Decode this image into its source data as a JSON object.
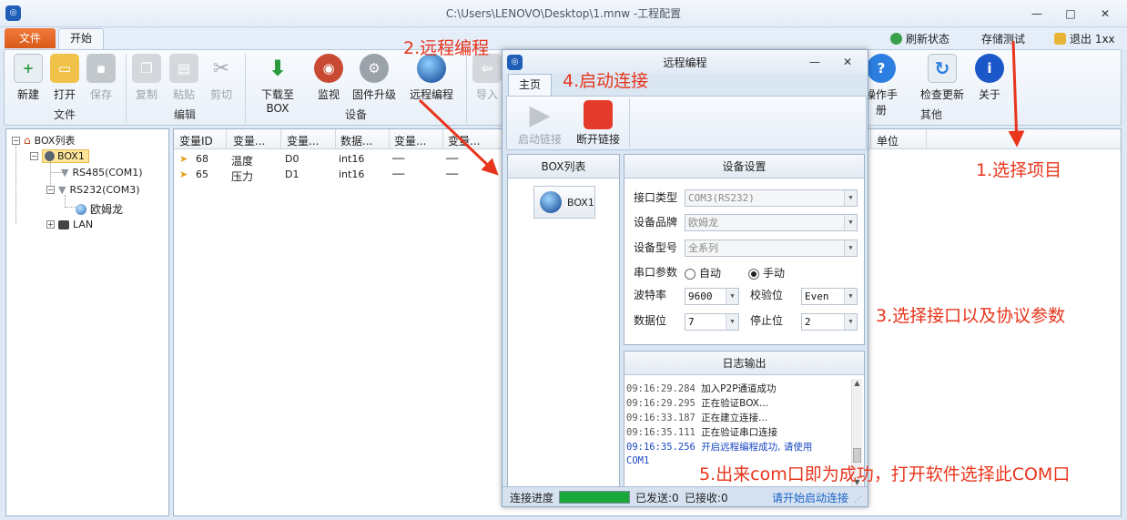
{
  "window": {
    "app_icon": "app-logo-icon",
    "title": "C:\\Users\\LENOVO\\Desktop\\1.mnw  -工程配置",
    "minimize": "—",
    "maximize": "□",
    "close": "✕"
  },
  "tabs": {
    "file": "文件",
    "start": "开始"
  },
  "quick": {
    "refresh": "刷新状态",
    "storage": "存储测试",
    "logout": "退出 1xx"
  },
  "ribbon": {
    "new": "新建",
    "open": "打开",
    "save": "保存",
    "copy": "复制",
    "paste": "粘贴",
    "cut": "剪切",
    "download": "下载至BOX",
    "monitor": "监视",
    "firmware": "固件升级",
    "remote": "远程编程",
    "import": "导入",
    "manual": "操作手册",
    "update": "检查更新",
    "about": "关于",
    "groups": {
      "file": "文件",
      "edit": "编辑",
      "device": "设备",
      "other": "其他"
    }
  },
  "tree": {
    "root": "BOX列表",
    "box1": "BOX1",
    "rs485": "RS485(COM1)",
    "rs232": "RS232(COM3)",
    "omron": "欧姆龙",
    "lan": "LAN"
  },
  "grid": {
    "columns": [
      "变量ID",
      "变量...",
      "变量...",
      "数据...",
      "变量...",
      "变量...",
      "单位"
    ],
    "rows": [
      {
        "id": "68",
        "name": "温度",
        "addr": "D0",
        "type": "int16",
        "c5": "──",
        "c6": "──"
      },
      {
        "id": "65",
        "name": "压力",
        "addr": "D1",
        "type": "int16",
        "c5": "──",
        "c6": "──"
      }
    ]
  },
  "dialog": {
    "title": "远程编程",
    "tab": "主页",
    "start_link": "启动链接",
    "stop_link": "断开链接",
    "box_list_header": "BOX列表",
    "box_item": "BOX1",
    "settings_header": "设备设置",
    "labels": {
      "port": "接口类型",
      "brand": "设备品牌",
      "model": "设备型号",
      "serial": "串口参数",
      "baud": "波特率",
      "parity": "校验位",
      "databits": "数据位",
      "stopbits": "停止位"
    },
    "values": {
      "port": "COM3(RS232)",
      "brand": "欧姆龙",
      "model": "全系列",
      "auto": "自动",
      "manual": "手动",
      "baud": "9600",
      "parity": "Even",
      "databits": "7",
      "stopbits": "2"
    },
    "log_header": "日志输出",
    "log": [
      {
        "time": "09:16:29.284",
        "msg": "加入P2P通道成功"
      },
      {
        "time": "09:16:29.295",
        "msg": "正在验证BOX..."
      },
      {
        "time": "09:16:33.187",
        "msg": "正在建立连接..."
      },
      {
        "time": "09:16:35.111",
        "msg": "正在验证串口连接"
      },
      {
        "time": "09:16:35.256",
        "msg": "开启远程编程成功, 请使用"
      }
    ],
    "log_tail": "COM1",
    "status": {
      "progress_label": "连接进度",
      "progress": 1.0,
      "sent": "已发送:0",
      "recv": "已接收:0",
      "hint": "请开始启动连接"
    }
  },
  "annotations": {
    "a1": "1.选择项目",
    "a2": "2.远程编程",
    "a3": "3.选择接口以及协议参数",
    "a4": "4.启动连接",
    "a5": "5.出来com口即为成功，打开软件选择此COM口"
  },
  "colors": {
    "annotation": "#e8351c",
    "progress": "#1ba83a",
    "accent": "#1f5fb8"
  }
}
